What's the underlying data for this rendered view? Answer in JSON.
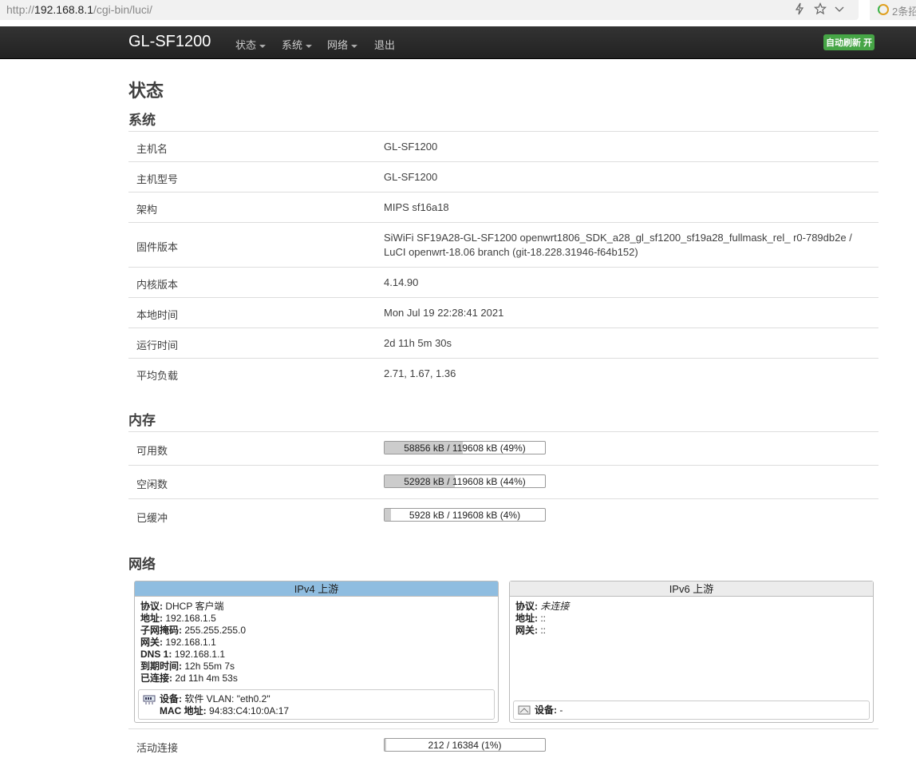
{
  "browser": {
    "url_prefix": "http://",
    "url_host": "192.168.8.1",
    "url_path": "/cgi-bin/luci/",
    "ext_text": "2条招"
  },
  "navbar": {
    "brand": "GL-SF1200",
    "menu": [
      {
        "label": "状态",
        "dropdown": true
      },
      {
        "label": "系统",
        "dropdown": true
      },
      {
        "label": "网络",
        "dropdown": true
      },
      {
        "label": "退出",
        "dropdown": false
      }
    ],
    "auto_refresh": "自动刷新 开"
  },
  "page": {
    "title": "状态",
    "system": {
      "heading": "系统",
      "rows": [
        {
          "label": "主机名",
          "value": "GL-SF1200"
        },
        {
          "label": "主机型号",
          "value": "GL-SF1200"
        },
        {
          "label": "架构",
          "value": "MIPS sf16a18"
        },
        {
          "label": "固件版本",
          "value": "SiWiFi SF19A28-GL-SF1200 openwrt1806_SDK_a28_gl_sf1200_sf19a28_fullmask_rel_ r0-789db2e /",
          "value2": "LuCI openwrt-18.06 branch (git-18.228.31946-f64b152)"
        },
        {
          "label": "内核版本",
          "value": "4.14.90"
        },
        {
          "label": "本地时间",
          "value": "Mon Jul 19 22:28:41 2021"
        },
        {
          "label": "运行时间",
          "value": "2d 11h 5m 30s"
        },
        {
          "label": "平均负载",
          "value": "2.71, 1.67, 1.36"
        }
      ]
    },
    "memory": {
      "heading": "内存",
      "rows": [
        {
          "label": "可用数",
          "text": "58856 kB / 119608 kB (49%)",
          "fraction": 0.49
        },
        {
          "label": "空闲数",
          "text": "52928 kB / 119608 kB (44%)",
          "fraction": 0.44
        },
        {
          "label": "已缓冲",
          "text": "5928 kB / 119608 kB (4%)",
          "fraction": 0.04
        }
      ]
    },
    "network": {
      "heading": "网络",
      "ipv4": {
        "title": "IPv4 上游",
        "lines": [
          {
            "k": "协议:",
            "v": "DHCP 客户端"
          },
          {
            "k": "地址:",
            "v": "192.168.1.5"
          },
          {
            "k": "子网掩码:",
            "v": "255.255.255.0"
          },
          {
            "k": "网关:",
            "v": "192.168.1.1"
          },
          {
            "k": "DNS 1:",
            "v": "192.168.1.1"
          },
          {
            "k": "到期时间:",
            "v": "12h 55m 7s"
          },
          {
            "k": "已连接:",
            "v": "2d 11h 4m 53s"
          }
        ],
        "device_k": "设备:",
        "device_v": "软件 VLAN: \"eth0.2\"",
        "mac_k": "MAC 地址:",
        "mac_v": "94:83:C4:10:0A:17"
      },
      "ipv6": {
        "title": "IPv6 上游",
        "lines": [
          {
            "k": "协议:",
            "v": "未连接"
          },
          {
            "k": "地址:",
            "v": "::"
          },
          {
            "k": "网关:",
            "v": "::"
          }
        ],
        "device_k": "设备:",
        "device_v": "-"
      },
      "active_connections": {
        "label": "活动连接",
        "text": "212 / 16384 (1%)",
        "fraction": 0.01
      }
    }
  },
  "colors": {
    "ipv4_header": "#8fbde0",
    "ipv6_header": "#ececec",
    "badge": "#46a546"
  }
}
